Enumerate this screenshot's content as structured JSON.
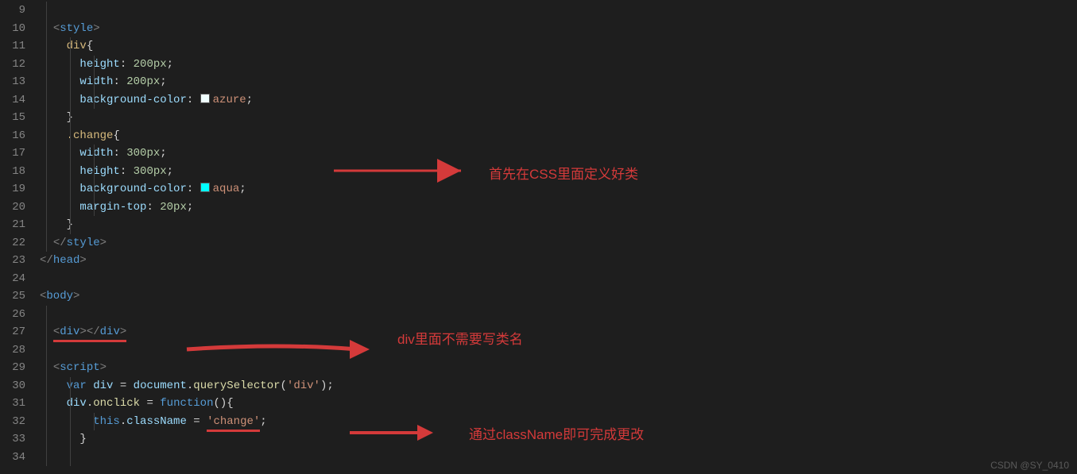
{
  "lineStart": 9,
  "lineEnd": 34,
  "code": {
    "l10": {
      "tag": "style"
    },
    "l11": {
      "selector": "div",
      "open": "{"
    },
    "l12": {
      "prop": "height",
      "value": "200px"
    },
    "l13": {
      "prop": "width",
      "value": "200px"
    },
    "l14": {
      "prop": "background-color",
      "value": "azure",
      "swatch": "azure"
    },
    "l15": {
      "close": "}"
    },
    "l16": {
      "selector": ".change",
      "open": "{"
    },
    "l17": {
      "prop": "width",
      "value": "300px"
    },
    "l18": {
      "prop": "height",
      "value": "300px"
    },
    "l19": {
      "prop": "background-color",
      "value": "aqua",
      "swatch": "aqua"
    },
    "l20": {
      "prop": "margin-top",
      "value": "20px"
    },
    "l21": {
      "close": "}"
    },
    "l22": {
      "closeTag": "style"
    },
    "l23": {
      "closeTag": "head"
    },
    "l25": {
      "tag": "body"
    },
    "l27": {
      "tag": "div",
      "selfClose": true
    },
    "l29": {
      "tag": "script"
    },
    "l30": {
      "kw": "var",
      "id": "div",
      "obj": "document",
      "method": "querySelector",
      "arg": "'div'"
    },
    "l31": {
      "obj": "div",
      "prop": "onclick",
      "kw2": "function"
    },
    "l32": {
      "this": "this",
      "prop": "className",
      "val": "'change'"
    },
    "l33": {
      "close": "}"
    }
  },
  "annotations": {
    "a1": "首先在CSS里面定义好类",
    "a2": "div里面不需要写类名",
    "a3": "通过className即可完成更改"
  },
  "watermark": "CSDN @SY_0410"
}
